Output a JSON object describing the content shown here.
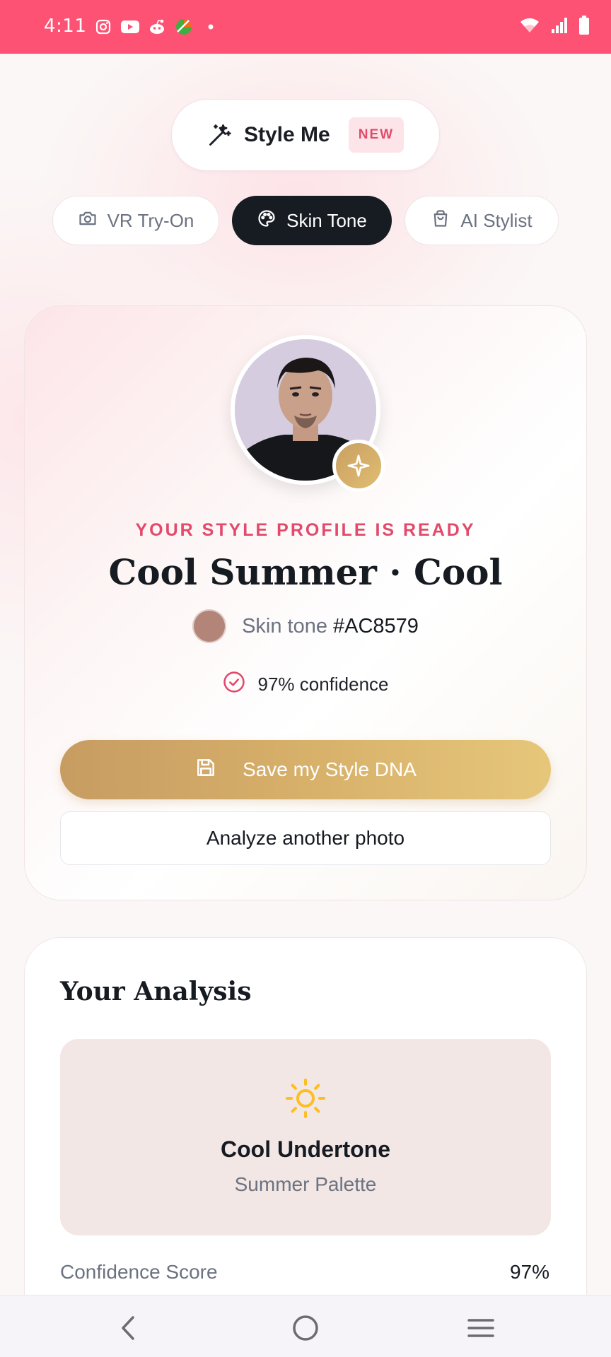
{
  "status_bar": {
    "time": "4:11",
    "left_icons": [
      "instagram-icon",
      "youtube-icon",
      "reddit-icon",
      "browser-icon",
      "dot-icon"
    ],
    "right_icons": [
      "wifi-icon",
      "signal-icon",
      "battery-icon"
    ],
    "background_color": "#fd5273"
  },
  "header": {
    "title": "Style Me",
    "badge": "NEW",
    "icon": "magic-wand-icon"
  },
  "tabs": [
    {
      "label": "VR Try-On",
      "icon": "camera-icon",
      "active": false
    },
    {
      "label": "Skin Tone",
      "icon": "palette-icon",
      "active": true
    },
    {
      "label": "AI Stylist",
      "icon": "shopping-bag-icon",
      "active": false
    }
  ],
  "profile": {
    "eyebrow": "YOUR STYLE PROFILE IS READY",
    "headline": "Cool Summer · Cool",
    "skin_tone_label": "Skin tone",
    "skin_tone_hex": "#AC8579",
    "confidence_text": "97% confidence",
    "save_button": "Save my Style DNA",
    "analyze_button": "Analyze another photo",
    "accent_color": "#e2496b",
    "gold_color": "#d7b06a"
  },
  "analysis": {
    "title": "Your Analysis",
    "undertone_title": "Cool Undertone",
    "undertone_sub": "Summer Palette",
    "undertone_icon": "sun-icon",
    "confidence_label": "Confidence Score",
    "confidence_value": "97%"
  },
  "nav": {
    "icons": [
      "back-icon",
      "home-icon",
      "menu-icon"
    ]
  }
}
